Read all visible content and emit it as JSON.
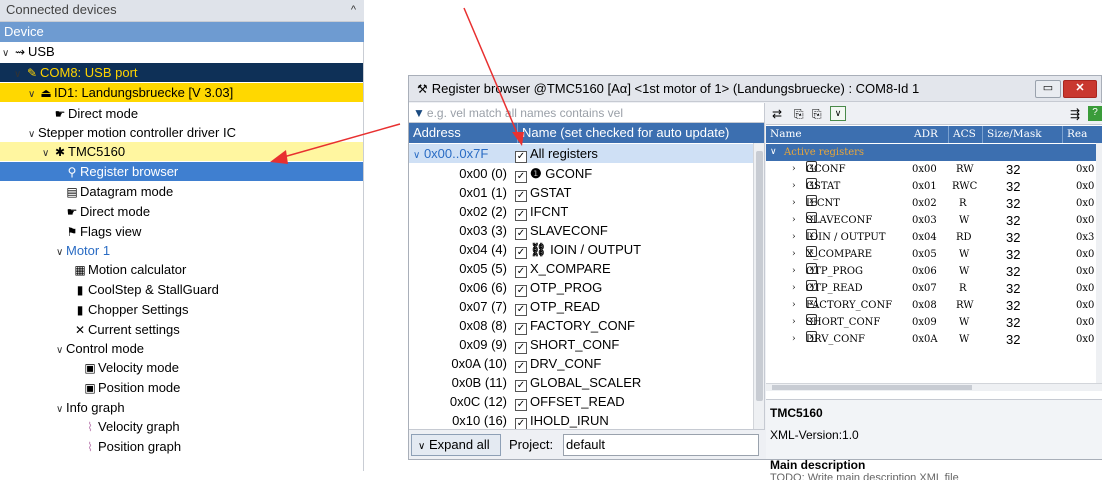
{
  "left_panel": {
    "title": "Connected devices",
    "header": "Device",
    "tree": [
      {
        "label": "USB"
      },
      {
        "label": "COM8: USB port"
      },
      {
        "label": "ID1: Landungsbruecke [V 3.03]"
      },
      {
        "label": "Direct mode"
      },
      {
        "label": "Stepper motion controller driver IC"
      },
      {
        "label": "TMC5160"
      },
      {
        "label": "Register browser"
      },
      {
        "label": "Datagram mode"
      },
      {
        "label": "Direct mode"
      },
      {
        "label": "Flags view"
      },
      {
        "label": "Motor 1"
      },
      {
        "label": "Motion calculator"
      },
      {
        "label": "CoolStep & StallGuard"
      },
      {
        "label": "Chopper Settings"
      },
      {
        "label": "Current settings"
      },
      {
        "label": "Control mode"
      },
      {
        "label": "Velocity mode"
      },
      {
        "label": "Position mode"
      },
      {
        "label": "Info graph"
      },
      {
        "label": "Velocity graph"
      },
      {
        "label": "Position graph"
      }
    ]
  },
  "window": {
    "title": "Register browser @TMC5160 [Aα] <1st motor of 1> (Landungsbruecke) : COM8-Id 1",
    "filter_placeholder": "e.g. vel match all names contains vel",
    "col_address": "Address",
    "col_name": "Name (set checked for auto update)",
    "range_row": {
      "addr": "0x00..0x7F",
      "name": "All registers"
    },
    "registers": [
      {
        "addr": "0x00 (0)",
        "name": "GCONF"
      },
      {
        "addr": "0x01 (1)",
        "name": "GSTAT"
      },
      {
        "addr": "0x02 (2)",
        "name": "IFCNT"
      },
      {
        "addr": "0x03 (3)",
        "name": "SLAVECONF"
      },
      {
        "addr": "0x04 (4)",
        "name": "IOIN / OUTPUT"
      },
      {
        "addr": "0x05 (5)",
        "name": "X_COMPARE"
      },
      {
        "addr": "0x06 (6)",
        "name": "OTP_PROG"
      },
      {
        "addr": "0x07 (7)",
        "name": "OTP_READ"
      },
      {
        "addr": "0x08 (8)",
        "name": "FACTORY_CONF"
      },
      {
        "addr": "0x09 (9)",
        "name": "SHORT_CONF"
      },
      {
        "addr": "0x0A (10)",
        "name": "DRV_CONF"
      },
      {
        "addr": "0x0B (11)",
        "name": "GLOBAL_SCALER"
      },
      {
        "addr": "0x0C (12)",
        "name": "OFFSET_READ"
      },
      {
        "addr": "0x10 (16)",
        "name": "IHOLD_IRUN"
      }
    ],
    "expand_all": "Expand all",
    "project_label": "Project:",
    "project_value": "default",
    "grid": {
      "headers": {
        "name": "Name",
        "adr": "ADR",
        "acs": "ACS",
        "size": "Size/Mask",
        "rea": "Rea"
      },
      "group": "Active registers",
      "rows": [
        {
          "name": "GCONF",
          "adr": "0x00",
          "acs": "RW",
          "size": "32",
          "rea": "0x0"
        },
        {
          "name": "GSTAT",
          "adr": "0x01",
          "acs": "RWC",
          "size": "32",
          "rea": "0x0"
        },
        {
          "name": "IFCNT",
          "adr": "0x02",
          "acs": "R",
          "size": "32",
          "rea": "0x0"
        },
        {
          "name": "SLAVECONF",
          "adr": "0x03",
          "acs": "W",
          "size": "32",
          "rea": "0x0"
        },
        {
          "name": "IOIN / OUTPUT",
          "adr": "0x04",
          "acs": "RD",
          "size": "32",
          "rea": "0x3"
        },
        {
          "name": "X_COMPARE",
          "adr": "0x05",
          "acs": "W",
          "size": "32",
          "rea": "0x0"
        },
        {
          "name": "OTP_PROG",
          "adr": "0x06",
          "acs": "W",
          "size": "32",
          "rea": "0x0"
        },
        {
          "name": "OTP_READ",
          "adr": "0x07",
          "acs": "R",
          "size": "32",
          "rea": "0x0"
        },
        {
          "name": "FACTORY_CONF",
          "adr": "0x08",
          "acs": "RW",
          "size": "32",
          "rea": "0x0"
        },
        {
          "name": "SHORT_CONF",
          "adr": "0x09",
          "acs": "W",
          "size": "32",
          "rea": "0x0"
        },
        {
          "name": "DRV_CONF",
          "adr": "0x0A",
          "acs": "W",
          "size": "32",
          "rea": "0x0"
        }
      ]
    },
    "desc": {
      "chip": "TMC5160",
      "xml_version": "XML-Version:1.0",
      "main_desc_title": "Main description",
      "main_desc_text": "TODO: Write main description XML file"
    }
  }
}
